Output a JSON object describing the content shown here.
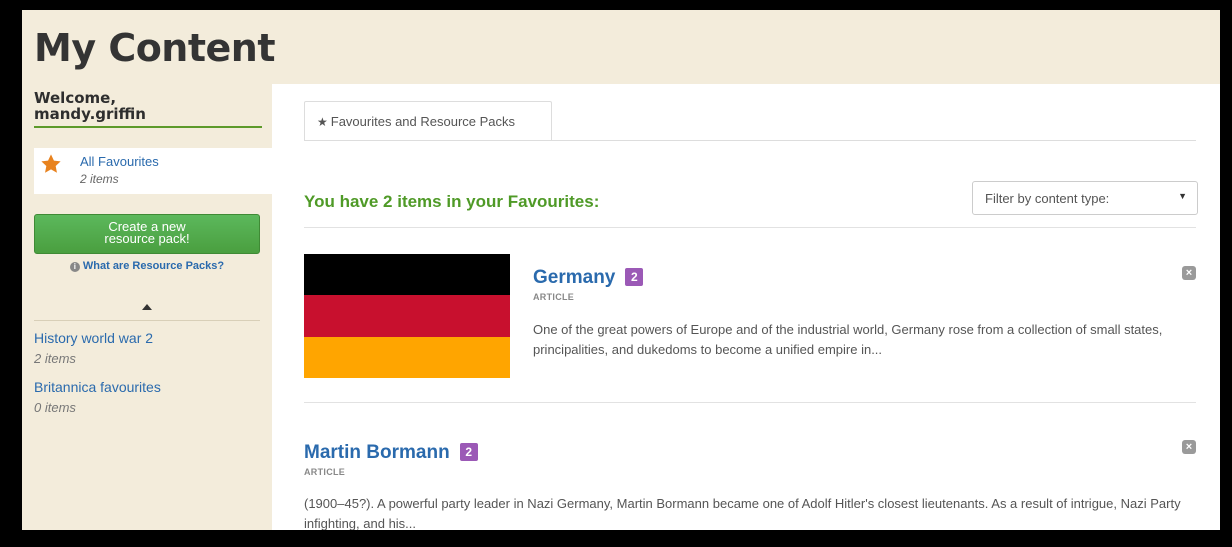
{
  "header": {
    "title": "My Content"
  },
  "sidebar": {
    "welcome_line1": "Welcome,",
    "username": "mandy.griffin",
    "all_favourites": {
      "label": "All Favourites",
      "count": "2 items",
      "icon": "star-icon"
    },
    "create_button": {
      "line1": "Create a new",
      "line2": "resource pack!"
    },
    "what_link": "What are Resource Packs?",
    "packs": [
      {
        "name": "History world war 2",
        "count": "2 items"
      },
      {
        "name": "Britannica favourites",
        "count": "0 items"
      }
    ]
  },
  "main": {
    "tab_label": "Favourites and Resource Packs",
    "heading": "You have 2 items in your Favourites:",
    "filter": {
      "selected": "Filter by content type:"
    },
    "items": [
      {
        "title": "Germany",
        "badge": "2",
        "type": "ARTICLE",
        "description": "One of the great powers of Europe and of the industrial world, Germany rose from a collection of small states, principalities, and dukedoms to become a unified empire in...",
        "flag_colors": [
          "#000000",
          "#c8102e",
          "#ffa500"
        ]
      },
      {
        "title": "Martin Bormann",
        "badge": "2",
        "type": "ARTICLE",
        "description": "(1900–45?). A powerful party leader in Nazi Germany, Martin Bormann became one of Adolf Hitler's closest lieutenants. As a result of intrigue, Nazi Party infighting, and his..."
      }
    ]
  },
  "colors": {
    "accent_green": "#4f9a27",
    "link_blue": "#2a6aad",
    "badge_purple": "#9b59b6",
    "sidebar_bg": "#f3ecdb"
  }
}
